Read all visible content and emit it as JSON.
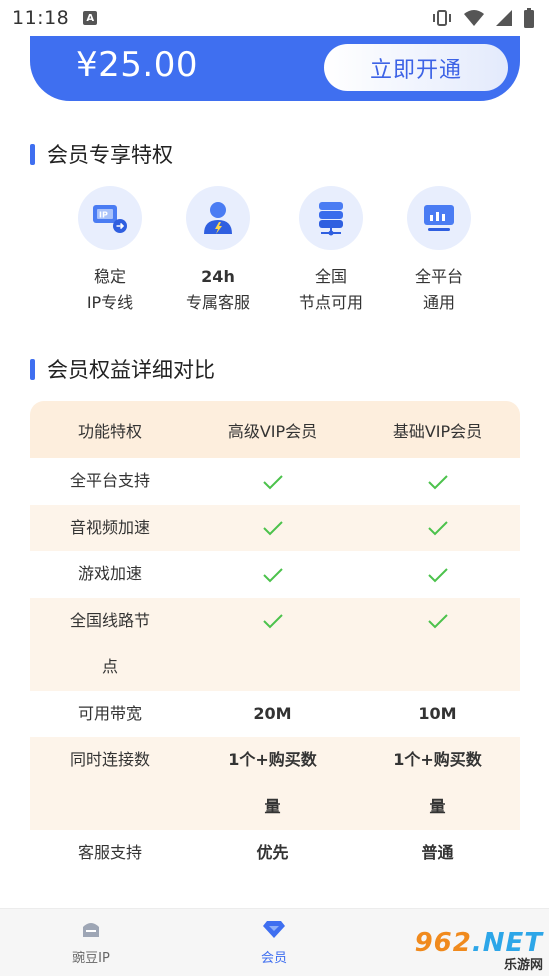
{
  "status_bar": {
    "time": "11:18",
    "notif_icon_letter": "A"
  },
  "price_bar": {
    "price": "¥25.00",
    "button_label": "立即开通"
  },
  "privileges": {
    "title": "会员专享特权",
    "items": [
      {
        "icon": "ip-line-icon",
        "line1": "稳定",
        "line2": "IP专线"
      },
      {
        "icon": "customer-service-icon",
        "line1": "24h",
        "line2": "专属客服"
      },
      {
        "icon": "server-node-icon",
        "line1": "全国",
        "line2": "节点可用"
      },
      {
        "icon": "platform-icon",
        "line1": "全平台",
        "line2": "通用"
      }
    ]
  },
  "comparison": {
    "title": "会员权益详细对比",
    "headers": [
      "功能特权",
      "高级VIP会员",
      "基础VIP会员"
    ],
    "rows": [
      {
        "feature": "全平台支持",
        "premium": "check",
        "basic": "check"
      },
      {
        "feature": "音视频加速",
        "premium": "check",
        "basic": "check"
      },
      {
        "feature": "游戏加速",
        "premium": "check",
        "basic": "check"
      },
      {
        "feature_l1": "全国线路节",
        "feature_l2": "点",
        "premium": "check",
        "basic": "check"
      },
      {
        "feature": "可用带宽",
        "premium": "20M",
        "basic": "10M"
      },
      {
        "feature": "同时连接数",
        "premium_l1": "1个+购买数",
        "premium_l2": "量",
        "basic_l1": "1个+购买数",
        "basic_l2": "量"
      },
      {
        "feature": "客服支持",
        "premium": "优先",
        "basic": "普通"
      }
    ]
  },
  "bottom_nav": {
    "items": [
      {
        "label": "豌豆IP",
        "active": false
      },
      {
        "label": "会员",
        "active": true
      }
    ]
  },
  "watermark": {
    "logo_a": "962",
    "logo_b": ".NET",
    "sub": "乐游网"
  },
  "colors": {
    "accent": "#3f6ff0",
    "table_header": "#fdeedd",
    "table_alt_row": "#fdf4ea",
    "check": "#4cc24c"
  }
}
